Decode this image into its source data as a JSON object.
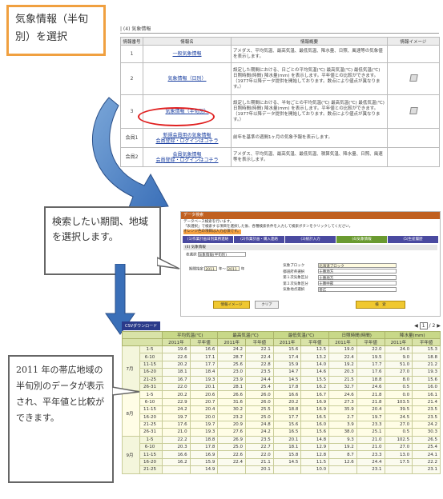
{
  "title_box": {
    "line1": "気象情報（半旬",
    "line2": "別）を選択"
  },
  "panel1": {
    "heading": "| (4) 気象情報",
    "headers": [
      "情報番号",
      "情報名",
      "情報概要",
      "情報イメージ"
    ],
    "rows": [
      {
        "no": "1",
        "name": "一般気象情報",
        "desc": "アメダス、平均気温、最高気温、最低気温、降水量、日照、風速等の気象値を表示します。",
        "img": false
      },
      {
        "no": "2",
        "name": "気象情報（日別）",
        "desc": "設定した期間における、日ごとの平均気温(℃) 最高気温(℃) 最低気温(℃) 日照時間(時間) 降水量(mm) を表示します。平年値との比較ができます。（1977年以降データ提供を開始しております。数点により値点が異なります。）",
        "img": true
      },
      {
        "no": "3",
        "name": "気象情報（半旬別）",
        "desc": "設定した期間における、半旬ごとの平均気温(℃) 最高気温(℃) 最低気温(℃) 日照時間(時間) 降水量(mm) を表示します。平年値との比較ができます。（1977年以降データ提供を開始しております。数点により値点が異なります。）",
        "img": true
      },
      {
        "no": "会員1",
        "name": "新規会員用の気象情報",
        "name2": "会員登録・ログインはコチラ",
        "desc": "前年を基準の週間1ヶ月の気象予報を表示します。",
        "img": false
      },
      {
        "no": "会員2",
        "name": "会員気象情報",
        "name2": "会員登録・ログインはコチラ",
        "desc": "アメダス、平均気温、最高気温、最低気温、積算気温、降水量、日照、風速等を表示します。",
        "img": false
      }
    ]
  },
  "panel2": {
    "bar": "データ検索",
    "notes": [
      "データベース検索を行います。",
      "「表選択」で検索する項目を選択した後、各種検索条件を入力して検索ボタンをクリックしてください。",
      "オレンジ色の項目は入力必須です。"
    ],
    "tabs": [
      "(1)作業計画日別業務連絡",
      "(2)作業計画・購入連絡",
      "(3)統計入力",
      "(4)気象情報",
      "(5)生産履歴"
    ],
    "sub": "(4) 気象情報",
    "table_select_label": "表選択",
    "table_select_value": "気象情報(半旬別)",
    "period_label": "期間指定",
    "period_year": "2011",
    "period_sep": "年〜",
    "period_year2": "2011",
    "period_end": "年",
    "block_label": "気象ブロック",
    "block_value": "北海道ブロック",
    "pref_label": "都道府県選択",
    "pref_value": "十勝地方",
    "area1_label": "第１次気象区分",
    "area1_value": "十勝地方",
    "area2_label": "第２次気象区分",
    "area2_value": "十勝中部",
    "obs_label": "気象地点選択",
    "obs_value": "帯広",
    "btn_search": "検　索",
    "btn_image": "情報イメージ",
    "btn_clear": "クリア"
  },
  "note1": {
    "text": "検索したい期間、地域を選択します。"
  },
  "note2": {
    "text": "2011 年の帯広地域の半旬別のデータが表示され、平年値と比較ができます。"
  },
  "panel3": {
    "download": "CSVダウンロード",
    "page_current": "1",
    "page_total": "2",
    "groups": [
      "平均気温(℃)",
      "最高気温(℃)",
      "最低気温(℃)",
      "日照時間(時間)",
      "降水量(mm)"
    ],
    "sub": [
      "2011年",
      "平年値"
    ],
    "months": [
      "7月",
      "8月",
      "9月"
    ],
    "periods": [
      "1-5",
      "6-10",
      "11-15",
      "16-20",
      "21-25",
      "26-31",
      "1-5",
      "6-10",
      "11-15",
      "16-20",
      "21-25",
      "26-31",
      "1-5",
      "6-10",
      "11-15",
      "16-20",
      "21-25"
    ],
    "values": [
      [
        "19.6",
        "16.6",
        "24.2",
        "22.1",
        "15.6",
        "12.5",
        "19.0",
        "22.0",
        "24.0",
        "15.3"
      ],
      [
        "22.6",
        "17.1",
        "28.7",
        "22.4",
        "17.4",
        "13.2",
        "22.4",
        "19.5",
        "9.0",
        "18.8"
      ],
      [
        "20.2",
        "17.7",
        "25.6",
        "22.8",
        "15.9",
        "14.0",
        "19.2",
        "17.7",
        "51.0",
        "21.2"
      ],
      [
        "18.1",
        "18.4",
        "23.0",
        "23.5",
        "14.7",
        "14.6",
        "20.3",
        "17.6",
        "27.0",
        "19.3"
      ],
      [
        "16.7",
        "19.3",
        "23.9",
        "24.4",
        "14.5",
        "15.5",
        "21.5",
        "18.8",
        "8.0",
        "15.6"
      ],
      [
        "22.0",
        "20.1",
        "28.1",
        "25.4",
        "17.8",
        "16.2",
        "32.7",
        "24.6",
        "0.5",
        "16.0"
      ],
      [
        "20.2",
        "20.6",
        "26.6",
        "26.0",
        "16.6",
        "16.7",
        "24.6",
        "21.8",
        "0.0",
        "16.1"
      ],
      [
        "22.9",
        "20.7",
        "31.6",
        "26.0",
        "20.2",
        "16.9",
        "27.3",
        "21.8",
        "103.5",
        "21.4"
      ],
      [
        "24.2",
        "20.4",
        "30.2",
        "25.5",
        "18.8",
        "16.9",
        "35.9",
        "20.4",
        "39.5",
        "23.5"
      ],
      [
        "19.7",
        "20.0",
        "23.2",
        "25.0",
        "17.7",
        "16.5",
        "2.7",
        "19.7",
        "24.5",
        "23.5"
      ],
      [
        "17.6",
        "19.7",
        "20.9",
        "24.8",
        "15.6",
        "16.0",
        "3.9",
        "23.3",
        "27.0",
        "24.2"
      ],
      [
        "21.0",
        "19.3",
        "27.6",
        "24.2",
        "16.5",
        "15.6",
        "38.0",
        "25.1",
        "0.5",
        "30.3"
      ],
      [
        "22.2",
        "18.8",
        "26.9",
        "23.5",
        "20.1",
        "14.8",
        "9.3",
        "21.0",
        "102.5",
        "26.5"
      ],
      [
        "20.3",
        "17.8",
        "25.0",
        "22.7",
        "18.1",
        "12.9",
        "19.2",
        "21.0",
        "27.0",
        "25.4"
      ],
      [
        "16.6",
        "16.9",
        "22.6",
        "22.0",
        "15.8",
        "12.8",
        "8.7",
        "23.3",
        "13.0",
        "24.1"
      ],
      [
        "16.2",
        "15.9",
        "22.4",
        "21.1",
        "14.5",
        "11.5",
        "12.6",
        "24.4",
        "17.5",
        "22.2"
      ],
      [
        "",
        "14.9",
        "",
        "20.1",
        "",
        "10.0",
        "",
        "23.1",
        "",
        "23.1"
      ]
    ]
  }
}
